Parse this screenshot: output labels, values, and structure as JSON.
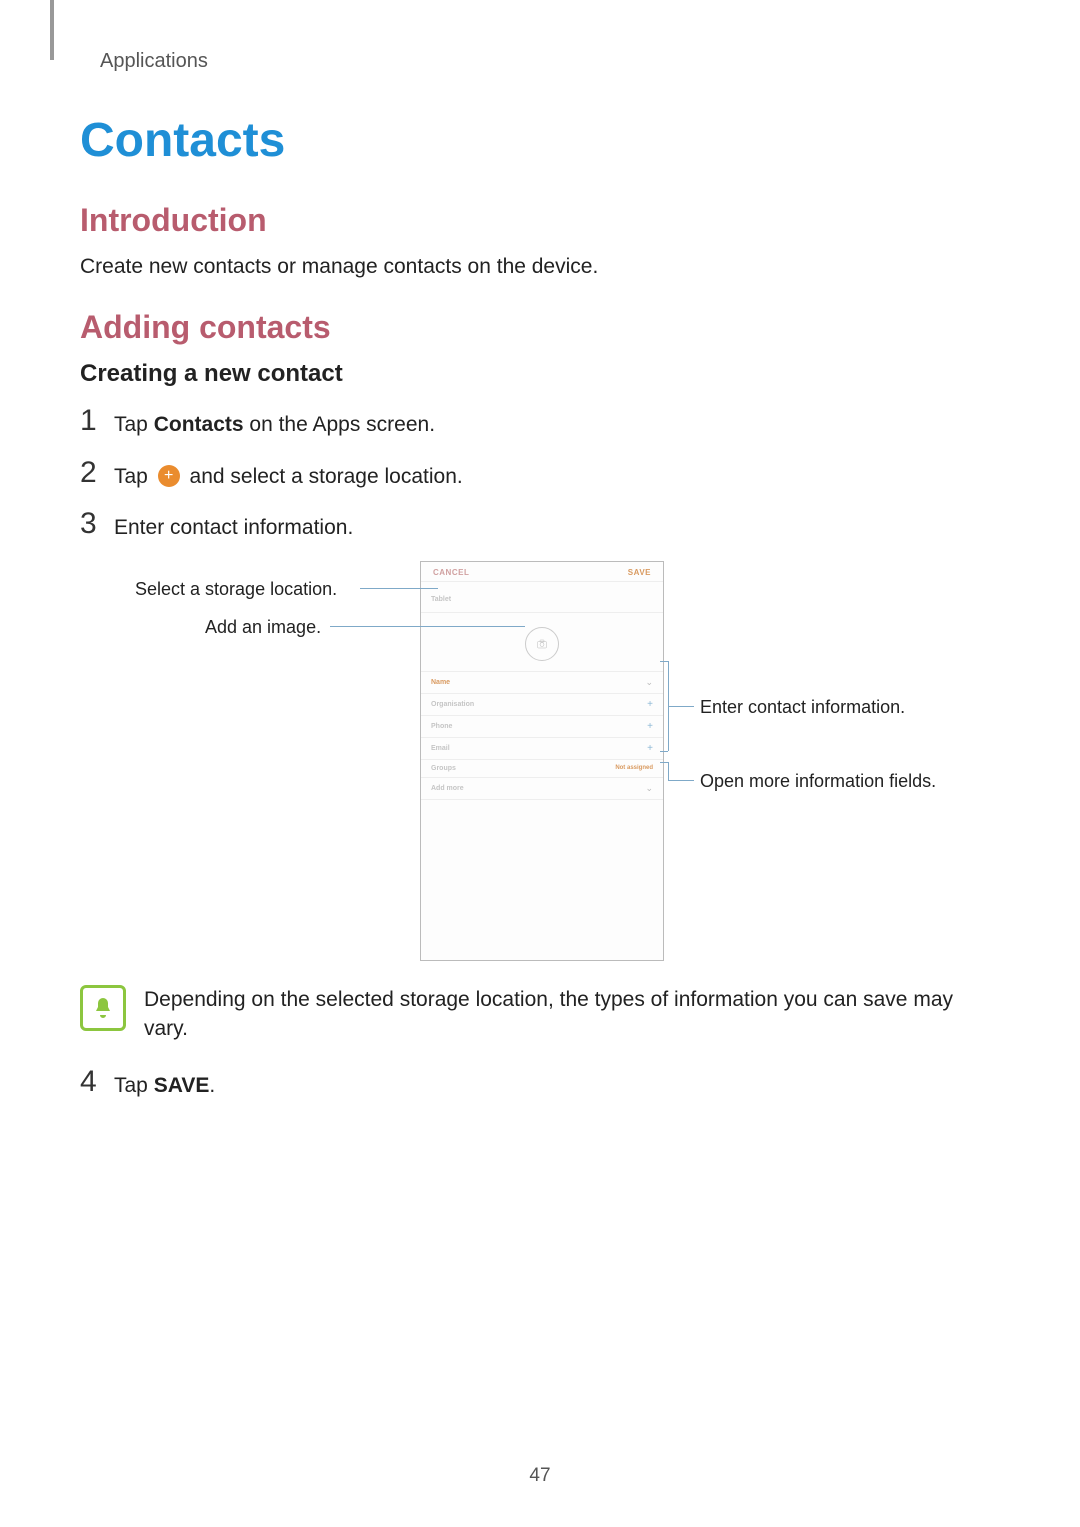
{
  "section_label": "Applications",
  "title": "Contacts",
  "subhead_intro": "Introduction",
  "intro_body": "Create new contacts or manage contacts on the device.",
  "subhead_adding": "Adding contacts",
  "subsub_creating": "Creating a new contact",
  "steps": {
    "s1_num": "1",
    "s1_before": "Tap ",
    "s1_bold": "Contacts",
    "s1_after": " on the Apps screen.",
    "s2_num": "2",
    "s2_before": "Tap ",
    "s2_after": " and select a storage location.",
    "s3_num": "3",
    "s3_text": "Enter contact information.",
    "s4_num": "4",
    "s4_before": "Tap ",
    "s4_bold": "SAVE",
    "s4_after": "."
  },
  "callouts": {
    "left_storage": "Select a storage location.",
    "left_image": "Add an image.",
    "right_info": "Enter contact information.",
    "right_more": "Open more information fields."
  },
  "phone": {
    "cancel": "CANCEL",
    "save": "SAVE",
    "storage": "Tablet",
    "fields": {
      "name": "Name",
      "org": "Organisation",
      "phone": "Phone",
      "email": "Email",
      "groups": "Groups",
      "groups_value": "Not assigned",
      "more": "Add more"
    }
  },
  "note_text": "Depending on the selected storage location, the types of information you can save may vary.",
  "page_number": "47"
}
